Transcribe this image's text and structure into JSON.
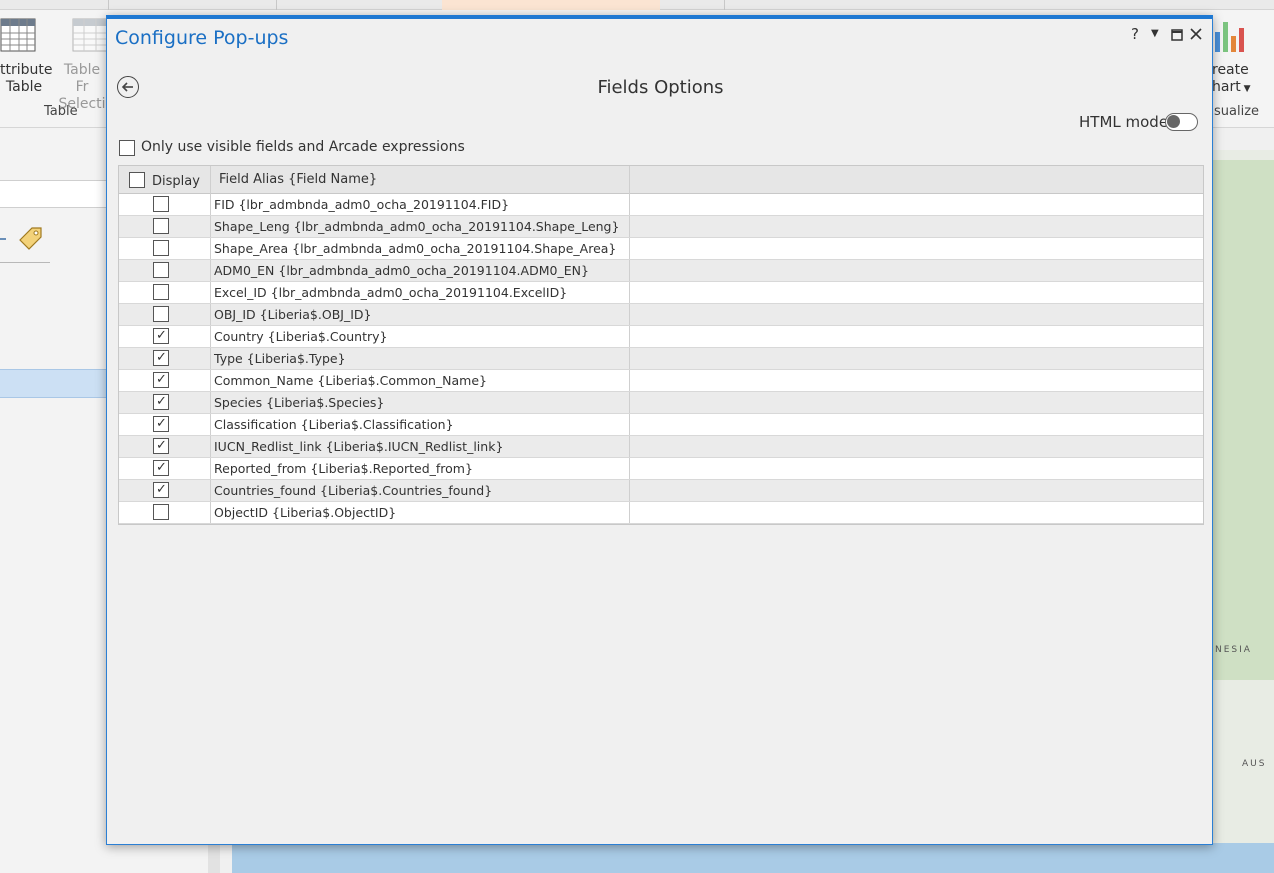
{
  "ribbon": {
    "attribute_table_line1": "ttribute",
    "attribute_table_line2": "Table",
    "table_from_selection_line1": "Table Fr",
    "table_from_selection_line2": "Selecti",
    "group_table_label": "Table",
    "create_chart_line1": "reate",
    "create_chart_line2": "hart",
    "group_visualize_label": "sualize"
  },
  "map": {
    "label_nesia": "NESIA",
    "label_aus": "AUS"
  },
  "dialog": {
    "title": "Configure Pop-ups",
    "help_glyph": "?",
    "subtitle": "Fields Options",
    "html_mode_label": "HTML mode",
    "html_mode_on": false,
    "only_visible_label": "Only use visible fields and Arcade expressions",
    "only_visible_checked": false,
    "table": {
      "headers": {
        "display": "Display",
        "field_alias": "Field Alias {Field Name}"
      },
      "rows": [
        {
          "alias": "FID {lbr_admbnda_adm0_ocha_20191104.FID}",
          "checked": false
        },
        {
          "alias": "Shape_Leng {lbr_admbnda_adm0_ocha_20191104.Shape_Leng}",
          "checked": false
        },
        {
          "alias": "Shape_Area {lbr_admbnda_adm0_ocha_20191104.Shape_Area}",
          "checked": false
        },
        {
          "alias": "ADM0_EN {lbr_admbnda_adm0_ocha_20191104.ADM0_EN}",
          "checked": false
        },
        {
          "alias": "Excel_ID {lbr_admbnda_adm0_ocha_20191104.ExcelID}",
          "checked": false
        },
        {
          "alias": "OBJ_ID {Liberia$.OBJ_ID}",
          "checked": false
        },
        {
          "alias": "Country {Liberia$.Country}",
          "checked": true
        },
        {
          "alias": "Type {Liberia$.Type}",
          "checked": true
        },
        {
          "alias": "Common_Name {Liberia$.Common_Name}",
          "checked": true
        },
        {
          "alias": "Species {Liberia$.Species}",
          "checked": true
        },
        {
          "alias": "Classification {Liberia$.Classification}",
          "checked": true
        },
        {
          "alias": "IUCN_Redlist_link {Liberia$.IUCN_Redlist_link}",
          "checked": true
        },
        {
          "alias": "Reported_from {Liberia$.Reported_from}",
          "checked": true
        },
        {
          "alias": "Countries_found {Liberia$.Countries_found}",
          "checked": true
        },
        {
          "alias": "ObjectID {Liberia$.ObjectID}",
          "checked": false
        }
      ]
    }
  }
}
